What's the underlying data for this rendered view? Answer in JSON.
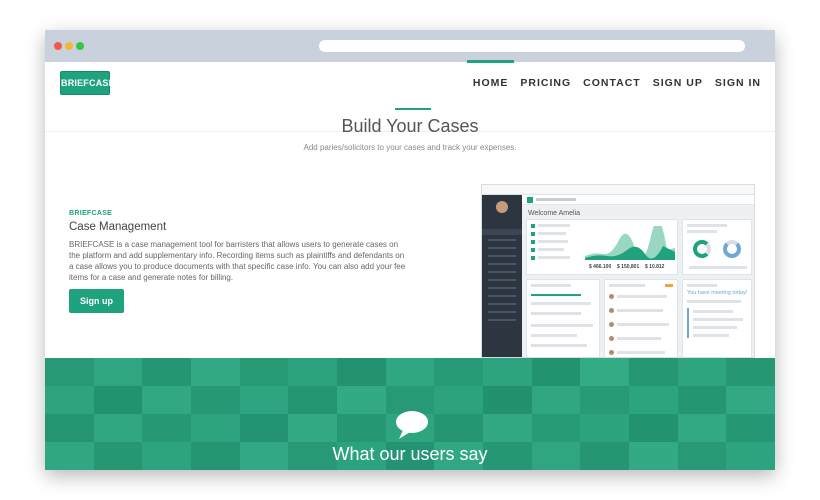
{
  "nav": {
    "logo": "BRIEFCASE",
    "items": [
      "HOME",
      "PRICING",
      "CONTACT",
      "SIGN UP",
      "SIGN IN"
    ],
    "active": "HOME"
  },
  "hero": {
    "title": "Build Your Cases",
    "subtitle": "Add paries/solicitors to your cases and track your expenses."
  },
  "feature": {
    "label": "BRIEFCASE",
    "title": "Case Management",
    "description": "BRIEFCASE is a case management tool for barristers that allows users to generate cases on the platform and add supplementary info. Recording items such as plaintiffs and defendants on a case allows you to produce documents with that specific case info. You can also add your fee items for a case and generate notes for billing.",
    "button": "Sign up"
  },
  "dashboard_preview": {
    "welcome": "Welcome Amelia",
    "kpis": [
      "$ 466.100",
      "$ 150,801",
      "$ 10.812"
    ],
    "meeting": "You have meeting today!"
  },
  "testimonials": {
    "title": "What our users say",
    "icon": "speech-bubble-icon"
  },
  "colors": {
    "accent": "#1fa37f",
    "band": "#2ba57f"
  }
}
